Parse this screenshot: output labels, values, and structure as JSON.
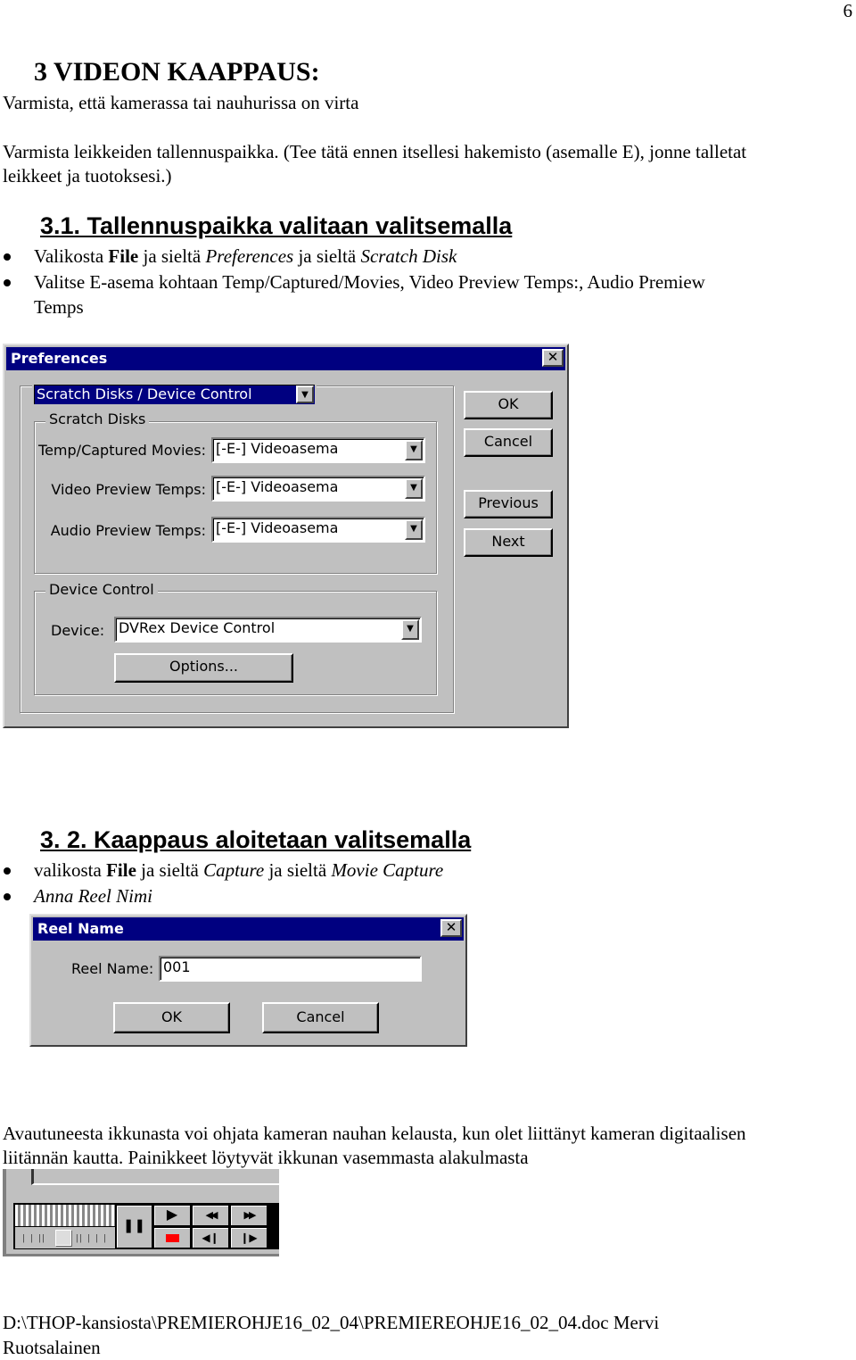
{
  "page_number": "6",
  "heading": "3 VIDEON KAAPPAUS:",
  "intro": "Varmista, että kamerassa tai nauhurissa on virta",
  "para1_line1": "Varmista leikkeiden tallennuspaikka. (Tee tätä ennen itsellesi hakemisto (asemalle E), jonne talletat",
  "para1_line2": "leikkeet ja tuotoksesi.)",
  "section1": {
    "title": "3.1. Tallennuspaikka valitaan valitsemalla",
    "b1": {
      "a": "Valikosta ",
      "b": "File",
      "c": " ja sieltä ",
      "d": "Preferences",
      "e": " ja sieltä ",
      "f": "Scratch Disk"
    },
    "b2_line1": "Valitse E-asema kohtaan Temp/Captured/Movies, Video Preview Temps:, Audio Premiew",
    "b2_line2": "Temps"
  },
  "preferences": {
    "title": "Preferences",
    "close": "✕",
    "panel": "Scratch Disks / Device Control",
    "scratch_group": "Scratch Disks",
    "rows": [
      {
        "label": "Temp/Captured Movies:",
        "value": "[-E-] Videoasema"
      },
      {
        "label": "Video Preview Temps:",
        "value": "[-E-] Videoasema"
      },
      {
        "label": "Audio Preview Temps:",
        "value": "[-E-] Videoasema"
      }
    ],
    "device_group": "Device Control",
    "device_label": "Device:",
    "device_value": "DVRex Device Control",
    "options": "Options...",
    "ok": "OK",
    "cancel": "Cancel",
    "previous": "Previous",
    "next": "Next"
  },
  "section2": {
    "title": "3. 2. Kaappaus aloitetaan valitsemalla",
    "b1": {
      "a": "valikosta  ",
      "b": "File",
      "c": " ja sieltä ",
      "d": "Capture",
      "e": " ja sieltä ",
      "f": "Movie Capture"
    },
    "b2": "Anna Reel Nimi"
  },
  "reel": {
    "title": "Reel Name",
    "close": "✕",
    "label": "Reel Name:",
    "value": "001",
    "ok": "OK",
    "cancel": "Cancel"
  },
  "para2_line1": "Avautuneesta ikkunasta voi ohjata kameran nauhan kelausta, kun olet liittänyt kameran digitaalisen",
  "para2_line2": "liitännän kautta.  Painikkeet löytyvät ikkunan vasemmasta alakulmasta",
  "controls": {
    "pause": "❚❚",
    "play": "▶",
    "rewind": "◀◀",
    "fast_forward": "▶▶",
    "step_back": "◀❙",
    "step_forward": "❙▶",
    "record_color": "#ff0000"
  },
  "footer_line1": "D:\\THOP-kansiosta\\PREMIEROHJE16_02_04\\PREMIEREOHJE16_02_04.doc Mervi",
  "footer_line2": "Ruotsalainen"
}
